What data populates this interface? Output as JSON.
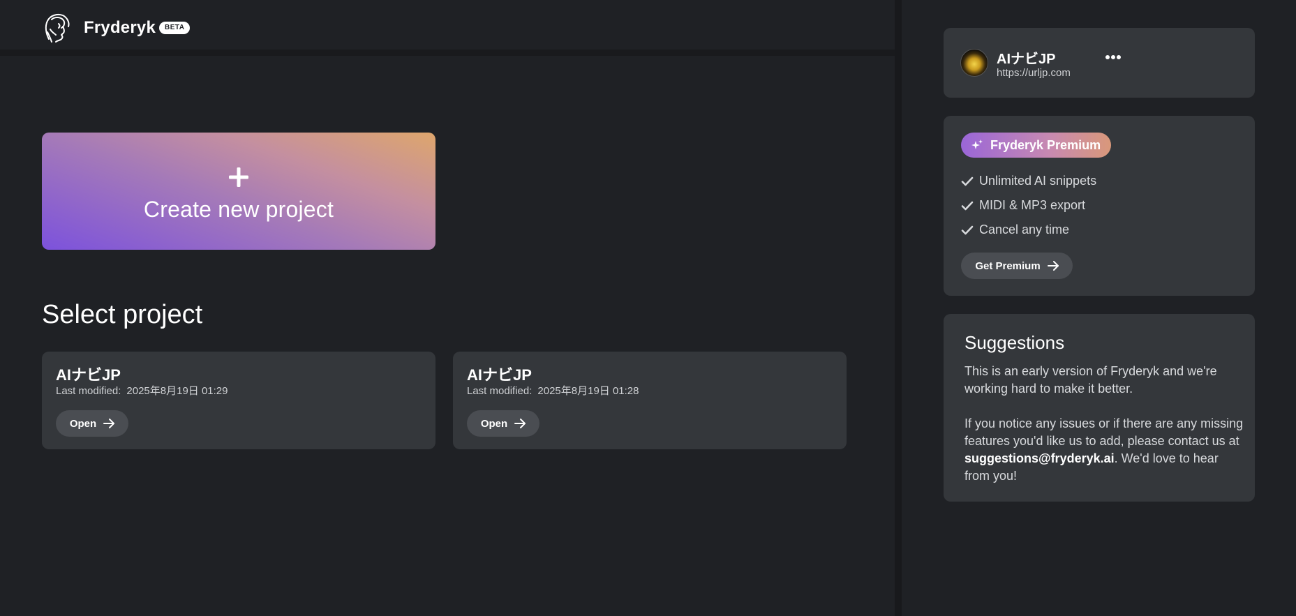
{
  "header": {
    "brand": "Fryderyk",
    "badge": "BETA"
  },
  "create": {
    "label": "Create new project"
  },
  "projects": {
    "title": "Select project",
    "items": [
      {
        "title": "AIナビJP",
        "modified_label": "Last modified:",
        "modified_value": "2025年8月19日 01:29",
        "open_label": "Open"
      },
      {
        "title": "AIナビJP",
        "modified_label": "Last modified:",
        "modified_value": "2025年8月19日 01:28",
        "open_label": "Open"
      }
    ]
  },
  "account": {
    "name": "AIナビJP",
    "url": "https://urljp.com"
  },
  "premium": {
    "badge": "Fryderyk Premium",
    "features": [
      "Unlimited AI snippets",
      "MIDI & MP3 export",
      "Cancel any time"
    ],
    "cta": "Get Premium"
  },
  "suggestions": {
    "title": "Suggestions",
    "para1": "This is an early version of Fryderyk and we're working hard to make it better.",
    "para2_before": "If you notice any issues or if there are any missing features you'd like us to add, please contact us at ",
    "email": "suggestions@fryderyk.ai",
    "para2_after": ". We'd love to hear from you!"
  },
  "colors": {
    "background": "#1f2125",
    "card": "#34373b",
    "button": "#4a4d52",
    "gradient_start": "#7c52dc",
    "gradient_end": "#dea66c"
  }
}
